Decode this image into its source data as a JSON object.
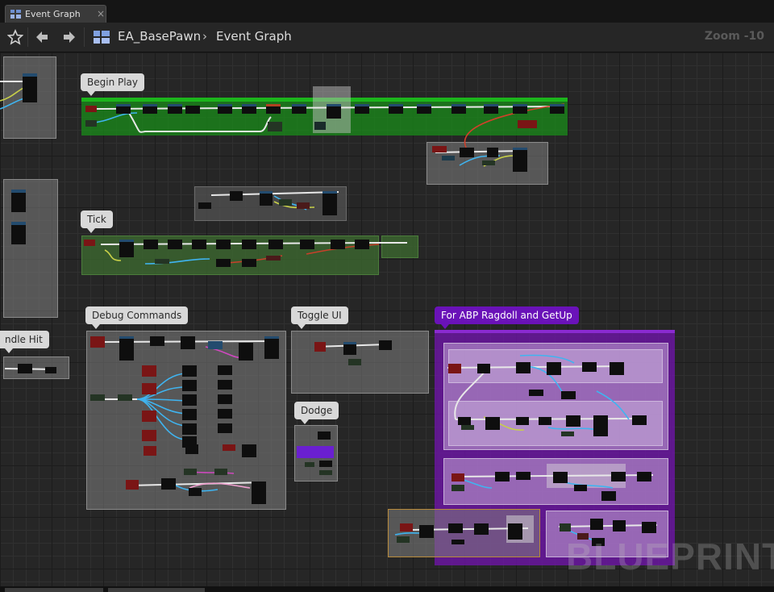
{
  "tab": {
    "title": "Event Graph",
    "close": "×"
  },
  "breadcrumb": {
    "blueprint": "EA_BasePawn",
    "separator": "›",
    "graph": "Event Graph"
  },
  "zoom": "Zoom -10",
  "comments": {
    "begin_play": "Begin Play",
    "tick": "Tick",
    "debug_commands": "Debug Commands",
    "toggle_ui": "Toggle UI",
    "dodge": "Dodge",
    "ragdoll": "For ABP Ragdoll and GetUp",
    "handle_hit": "ndle Hit"
  },
  "watermark": "BLUEPRINT"
}
